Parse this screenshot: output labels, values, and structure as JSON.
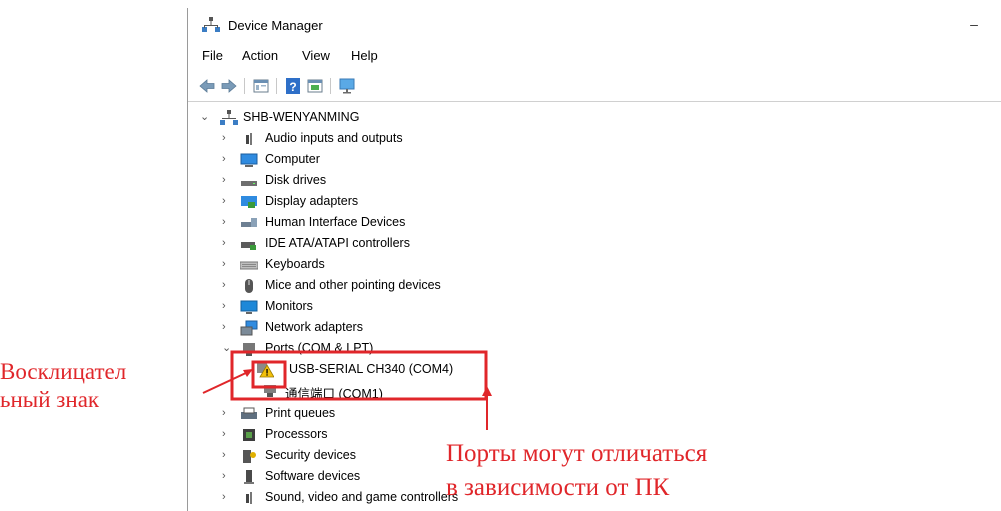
{
  "window": {
    "title": "Device Manager",
    "minimize_glyph": "–"
  },
  "menu": [
    "File",
    "Action",
    "View",
    "Help"
  ],
  "toolbar_icons": [
    "back-arrow-icon",
    "forward-arrow-icon",
    "properties-icon",
    "help-icon",
    "update-driver-icon",
    "monitor-scan-icon"
  ],
  "tree": {
    "root": "SHB-WENYANMING",
    "categories": [
      {
        "label": "Audio inputs and outputs",
        "icon": "speaker-icon"
      },
      {
        "label": "Computer",
        "icon": "computer-icon"
      },
      {
        "label": "Disk drives",
        "icon": "disk-drive-icon"
      },
      {
        "label": "Display adapters",
        "icon": "display-adapter-icon"
      },
      {
        "label": "Human Interface Devices",
        "icon": "hid-icon"
      },
      {
        "label": "IDE ATA/ATAPI controllers",
        "icon": "ide-controller-icon"
      },
      {
        "label": "Keyboards",
        "icon": "keyboard-icon"
      },
      {
        "label": "Mice and other pointing devices",
        "icon": "mouse-icon"
      },
      {
        "label": "Monitors",
        "icon": "monitor-icon"
      },
      {
        "label": "Network adapters",
        "icon": "network-adapter-icon"
      }
    ],
    "ports": {
      "label": "Ports (COM & LPT)",
      "children": [
        {
          "label": "USB-SERIAL CH340 (COM4)",
          "icon": "warning-port-icon"
        },
        {
          "label": "通信端口 (COM1)",
          "icon": "port-icon"
        }
      ]
    },
    "categories_after": [
      {
        "label": "Print queues",
        "icon": "printer-icon"
      },
      {
        "label": "Processors",
        "icon": "processor-icon"
      },
      {
        "label": "Security devices",
        "icon": "security-icon"
      },
      {
        "label": "Software devices",
        "icon": "software-device-icon"
      },
      {
        "label": "Sound, video and game controllers",
        "icon": "speaker-icon"
      }
    ]
  },
  "annotations": {
    "left_label_line1": "Восклицател",
    "left_label_line2": "ьный знак",
    "bottom_label_line1": "Порты могут отличаться",
    "bottom_label_line2": "в зависимости от ПК"
  },
  "colors": {
    "annotation_red": "#e0262a",
    "monitor_blue": "#1e88d8"
  }
}
